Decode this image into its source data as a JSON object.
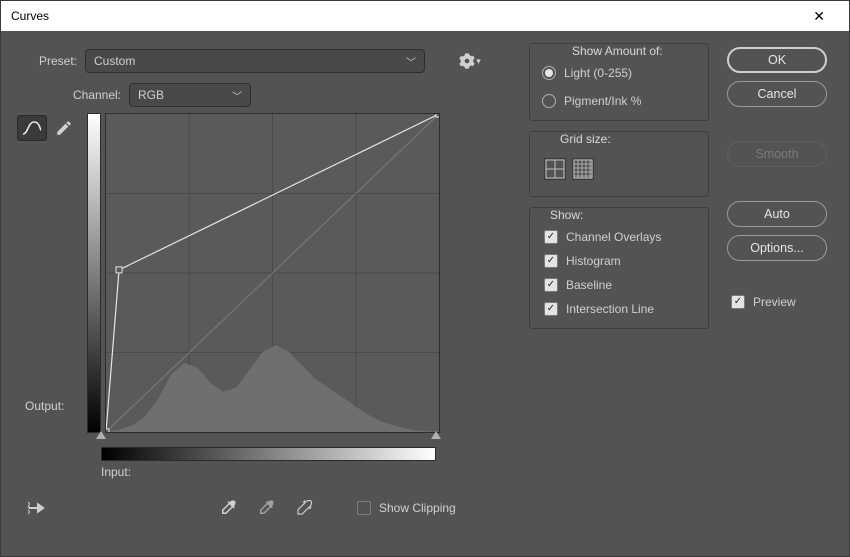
{
  "window": {
    "title": "Curves"
  },
  "preset": {
    "label": "Preset:",
    "value": "Custom"
  },
  "channel": {
    "label": "Channel:",
    "value": "RGB"
  },
  "output": {
    "label": "Output:"
  },
  "input": {
    "label": "Input:"
  },
  "show_clipping": {
    "label": "Show Clipping",
    "checked": false
  },
  "right": {
    "show_amount": {
      "header": "Show Amount of:",
      "light": {
        "label": "Light  (0-255)",
        "selected": true
      },
      "pigment": {
        "label": "Pigment/Ink %",
        "selected": false
      }
    },
    "grid": {
      "header": "Grid size:"
    },
    "show": {
      "header": "Show:",
      "items": [
        {
          "label": "Channel Overlays",
          "checked": true
        },
        {
          "label": "Histogram",
          "checked": true
        },
        {
          "label": "Baseline",
          "checked": true
        },
        {
          "label": "Intersection Line",
          "checked": true
        }
      ]
    }
  },
  "buttons": {
    "ok": "OK",
    "cancel": "Cancel",
    "smooth": "Smooth",
    "auto": "Auto",
    "options": "Options..."
  },
  "preview": {
    "label": "Preview",
    "checked": true
  },
  "chart_data": {
    "type": "line",
    "title": "Curves",
    "xlabel": "Input",
    "ylabel": "Output",
    "xlim": [
      0,
      255
    ],
    "ylim": [
      0,
      255
    ],
    "baseline": [
      [
        0,
        0
      ],
      [
        255,
        255
      ]
    ],
    "curve_points": [
      [
        0,
        0
      ],
      [
        10,
        130
      ],
      [
        255,
        255
      ]
    ],
    "histogram": {
      "x": [
        0,
        10,
        20,
        30,
        40,
        50,
        60,
        70,
        80,
        90,
        100,
        110,
        120,
        130,
        140,
        150,
        160,
        170,
        180,
        190,
        200,
        210,
        220,
        230,
        240,
        255
      ],
      "y": [
        0,
        2,
        6,
        14,
        30,
        52,
        62,
        58,
        44,
        36,
        40,
        56,
        72,
        78,
        72,
        60,
        48,
        40,
        32,
        24,
        16,
        10,
        6,
        3,
        1,
        0
      ],
      "y_max": 100
    },
    "slider_black": 0,
    "slider_white": 255
  }
}
